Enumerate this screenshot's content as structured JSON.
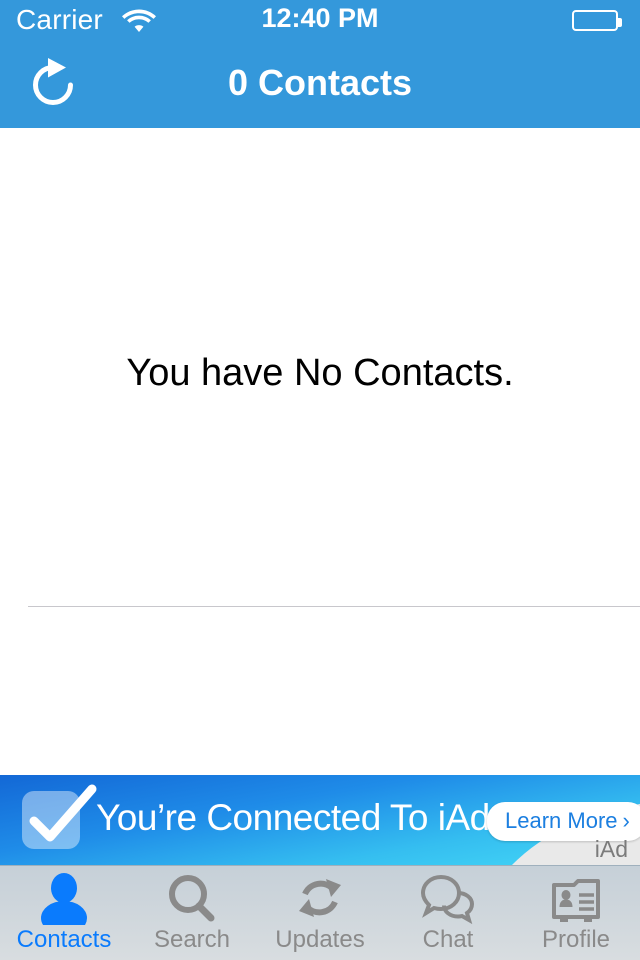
{
  "status_bar": {
    "carrier": "Carrier",
    "wifi_icon": "wifi-icon",
    "time": "12:40 PM",
    "battery_icon": "battery-icon"
  },
  "nav_bar": {
    "title": "0 Contacts",
    "refresh_icon": "refresh-icon",
    "background_color": "#3498db"
  },
  "content": {
    "empty_message": "You have No Contacts."
  },
  "ad_banner": {
    "check_icon": "checkmark-square-icon",
    "message": "You’re Connected To iAd",
    "learn_more_label": "Learn More",
    "chevron": "›",
    "network_label": "iAd"
  },
  "tab_bar": {
    "active_color": "#0a7bfd",
    "inactive_color": "#8a8a8a",
    "tabs": [
      {
        "label": "Contacts",
        "icon": "person-icon",
        "active": true
      },
      {
        "label": "Search",
        "icon": "magnifier-icon",
        "active": false
      },
      {
        "label": "Updates",
        "icon": "sync-arrows-icon",
        "active": false
      },
      {
        "label": "Chat",
        "icon": "speech-bubbles-icon",
        "active": false
      },
      {
        "label": "Profile",
        "icon": "contact-card-icon",
        "active": false
      }
    ]
  }
}
